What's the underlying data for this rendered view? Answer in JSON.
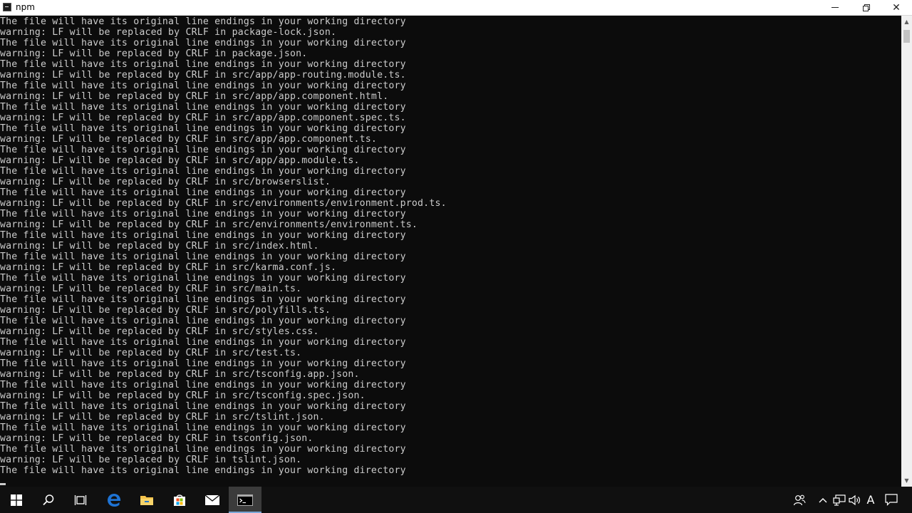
{
  "window": {
    "title": "npm",
    "controls": {
      "minimize": "",
      "restore": "",
      "close": "✕"
    }
  },
  "console": {
    "lines": [
      "The file will have its original line endings in your working directory",
      "warning: LF will be replaced by CRLF in package-lock.json.",
      "The file will have its original line endings in your working directory",
      "warning: LF will be replaced by CRLF in package.json.",
      "The file will have its original line endings in your working directory",
      "warning: LF will be replaced by CRLF in src/app/app-routing.module.ts.",
      "The file will have its original line endings in your working directory",
      "warning: LF will be replaced by CRLF in src/app/app.component.html.",
      "The file will have its original line endings in your working directory",
      "warning: LF will be replaced by CRLF in src/app/app.component.spec.ts.",
      "The file will have its original line endings in your working directory",
      "warning: LF will be replaced by CRLF in src/app/app.component.ts.",
      "The file will have its original line endings in your working directory",
      "warning: LF will be replaced by CRLF in src/app/app.module.ts.",
      "The file will have its original line endings in your working directory",
      "warning: LF will be replaced by CRLF in src/browserslist.",
      "The file will have its original line endings in your working directory",
      "warning: LF will be replaced by CRLF in src/environments/environment.prod.ts.",
      "The file will have its original line endings in your working directory",
      "warning: LF will be replaced by CRLF in src/environments/environment.ts.",
      "The file will have its original line endings in your working directory",
      "warning: LF will be replaced by CRLF in src/index.html.",
      "The file will have its original line endings in your working directory",
      "warning: LF will be replaced by CRLF in src/karma.conf.js.",
      "The file will have its original line endings in your working directory",
      "warning: LF will be replaced by CRLF in src/main.ts.",
      "The file will have its original line endings in your working directory",
      "warning: LF will be replaced by CRLF in src/polyfills.ts.",
      "The file will have its original line endings in your working directory",
      "warning: LF will be replaced by CRLF in src/styles.css.",
      "The file will have its original line endings in your working directory",
      "warning: LF will be replaced by CRLF in src/test.ts.",
      "The file will have its original line endings in your working directory",
      "warning: LF will be replaced by CRLF in src/tsconfig.app.json.",
      "The file will have its original line endings in your working directory",
      "warning: LF will be replaced by CRLF in src/tsconfig.spec.json.",
      "The file will have its original line endings in your working directory",
      "warning: LF will be replaced by CRLF in src/tslint.json.",
      "The file will have its original line endings in your working directory",
      "warning: LF will be replaced by CRLF in tsconfig.json.",
      "The file will have its original line endings in your working directory",
      "warning: LF will be replaced by CRLF in tslint.json.",
      "The file will have its original line endings in your working directory"
    ]
  },
  "taskbar": {
    "items": [
      {
        "icon": "windows-start-icon",
        "active": false
      },
      {
        "icon": "search-icon",
        "active": false
      },
      {
        "icon": "task-view-icon",
        "active": false
      },
      {
        "icon": "edge-browser-icon",
        "active": false
      },
      {
        "icon": "file-explorer-icon",
        "active": false
      },
      {
        "icon": "store-icon",
        "active": false
      },
      {
        "icon": "mail-icon",
        "active": false
      },
      {
        "icon": "command-prompt-icon",
        "active": true
      }
    ],
    "tray": {
      "ime_label": "A",
      "icons": [
        "people-icon",
        "chevron-up-icon",
        "network-icon",
        "volume-icon",
        "notification-icon"
      ]
    }
  },
  "colors": {
    "console_bg": "#0c0c0c",
    "console_fg": "#cccccc",
    "taskbar_bg": "#101010",
    "edge_blue": "#1e73d4",
    "explorer_yellow": "#f3c24b"
  }
}
